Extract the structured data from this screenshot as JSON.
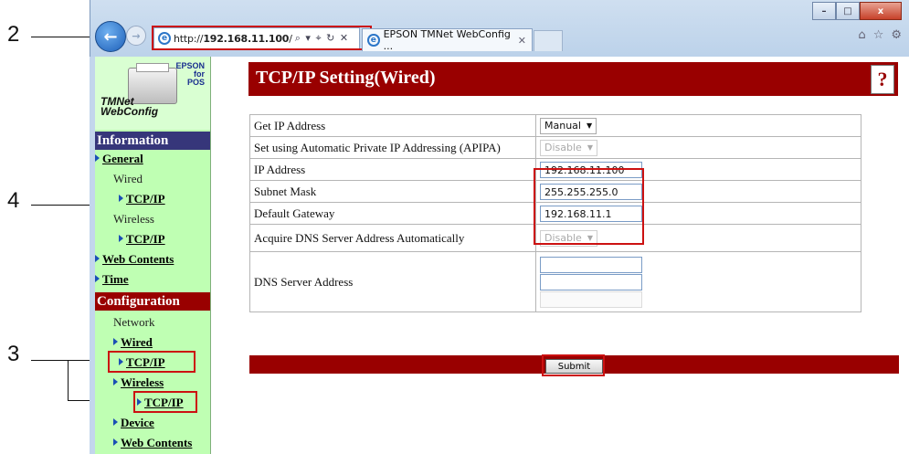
{
  "browser": {
    "url_prefix": "http://",
    "url_host": "192.168.11.100",
    "url_suffix": "/",
    "address_controls": "⌕ ▾ ⌖ ↻ ✕",
    "tab_title": "EPSON TMNet WebConfig ...",
    "tab_close": "✕",
    "window_controls": {
      "minimize": "–",
      "maximize": "□",
      "close": "x"
    },
    "toolbar_icons": [
      "home-icon",
      "star-icon",
      "gear-icon"
    ]
  },
  "sidebar": {
    "logo": {
      "brand": "EPSON",
      "brand_line2": "for",
      "brand_line3": "POS",
      "product_line1": "TMNet",
      "product_line2": "WebConfig"
    },
    "information_header": "Information",
    "general": "General",
    "wired": "Wired",
    "wired_tcpip": "TCP/IP",
    "wireless": "Wireless",
    "wireless_tcpip": "TCP/IP",
    "web_contents": "Web Contents",
    "time": "Time",
    "configuration_header": "Configuration",
    "network": "Network",
    "conf_wired": "Wired",
    "conf_wired_tcpip": "TCP/IP",
    "conf_wireless": "Wireless",
    "conf_wireless_tcpip": "TCP/IP",
    "device": "Device",
    "conf_web_contents": "Web Contents"
  },
  "page": {
    "title": "TCP/IP Setting(Wired)",
    "help_glyph": "?",
    "rows": {
      "get_ip": {
        "label": "Get IP Address",
        "value": "Manual"
      },
      "apipa": {
        "label": "Set using Automatic Private IP Addressing (APIPA)",
        "value": "Disable"
      },
      "ip": {
        "label": "IP Address",
        "value": "192.168.11.100"
      },
      "subnet": {
        "label": "Subnet Mask",
        "value": "255.255.255.0"
      },
      "gateway": {
        "label": "Default Gateway",
        "value": "192.168.11.1"
      },
      "dns_auto": {
        "label": "Acquire DNS Server Address Automatically",
        "value": "Disable"
      },
      "dns": {
        "label": "DNS Server Address",
        "values": [
          "",
          "",
          ""
        ]
      }
    },
    "submit_label": "Submit"
  },
  "callouts": {
    "c2": "2",
    "c3": "3",
    "c4": "4"
  },
  "colors": {
    "accent_red": "#990000",
    "info_blue": "#36367a",
    "sidebar_green": "#bfffb3",
    "highlight": "#cc1111"
  }
}
